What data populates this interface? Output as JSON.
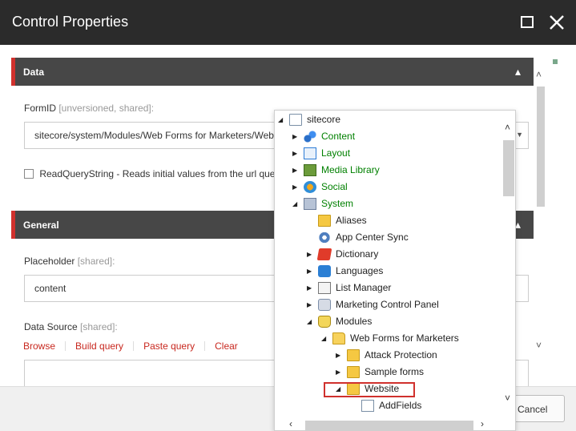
{
  "window": {
    "title": "Control Properties"
  },
  "titlebar_icons": [
    "maximize-icon",
    "close-icon"
  ],
  "sections": {
    "data": {
      "label": "Data"
    },
    "general": {
      "label": "General"
    }
  },
  "fields": {
    "form_id": {
      "label": "FormID",
      "meta": "[unversioned, shared]:",
      "value": "sitecore/system/Modules/Web Forms for Marketers/Webs"
    },
    "read_query_string": {
      "label": "ReadQueryString - Reads initial values from the url quer",
      "checked": false
    },
    "placeholder": {
      "label": "Placeholder",
      "meta": "[shared]:",
      "value": "content"
    },
    "data_source": {
      "label": "Data Source",
      "meta": "[shared]:",
      "links": [
        "Browse",
        "Build query",
        "Paste query",
        "Clear"
      ]
    }
  },
  "footer": {
    "cancel_label": "Cancel"
  },
  "tree": {
    "nodes": [
      {
        "label": "sitecore",
        "toggle": "expanded",
        "icon": "page-icon",
        "color": "black"
      },
      {
        "label": "Content",
        "toggle": "collapsed",
        "icon": "content-icon",
        "color": "green"
      },
      {
        "label": "Layout",
        "toggle": "collapsed",
        "icon": "layout-icon",
        "color": "green"
      },
      {
        "label": "Media Library",
        "toggle": "collapsed",
        "icon": "media-library-icon",
        "color": "green"
      },
      {
        "label": "Social",
        "toggle": "collapsed",
        "icon": "social-icon",
        "color": "green"
      },
      {
        "label": "System",
        "toggle": "expanded",
        "icon": "system-icon",
        "color": "green"
      },
      {
        "label": "Aliases",
        "toggle": "none",
        "icon": "folder-icon",
        "color": "black"
      },
      {
        "label": "App Center Sync",
        "toggle": "none",
        "icon": "gear-icon",
        "color": "black"
      },
      {
        "label": "Dictionary",
        "toggle": "collapsed",
        "icon": "dictionary-icon",
        "color": "black"
      },
      {
        "label": "Languages",
        "toggle": "collapsed",
        "icon": "languages-icon",
        "color": "black"
      },
      {
        "label": "List Manager",
        "toggle": "collapsed",
        "icon": "list-manager-icon",
        "color": "black"
      },
      {
        "label": "Marketing Control Panel",
        "toggle": "collapsed",
        "icon": "marketing-icon",
        "color": "black"
      },
      {
        "label": "Modules",
        "toggle": "expanded",
        "icon": "modules-icon",
        "color": "black"
      },
      {
        "label": "Web Forms for Marketers",
        "toggle": "expanded",
        "icon": "folder-open-icon",
        "color": "black"
      },
      {
        "label": "Attack Protection",
        "toggle": "collapsed",
        "icon": "folder-icon",
        "color": "black"
      },
      {
        "label": "Sample forms",
        "toggle": "collapsed",
        "icon": "folder-icon",
        "color": "black"
      },
      {
        "label": "Website",
        "toggle": "expanded",
        "icon": "folder-icon",
        "color": "black",
        "selected": true
      },
      {
        "label": "AddFields",
        "toggle": "none",
        "icon": "addfields-icon",
        "color": "black"
      }
    ]
  },
  "colors": {
    "accent": "#d0312d",
    "tree_green": "#008000",
    "header_bg": "#474747",
    "titlebar_bg": "#2b2b2b"
  }
}
